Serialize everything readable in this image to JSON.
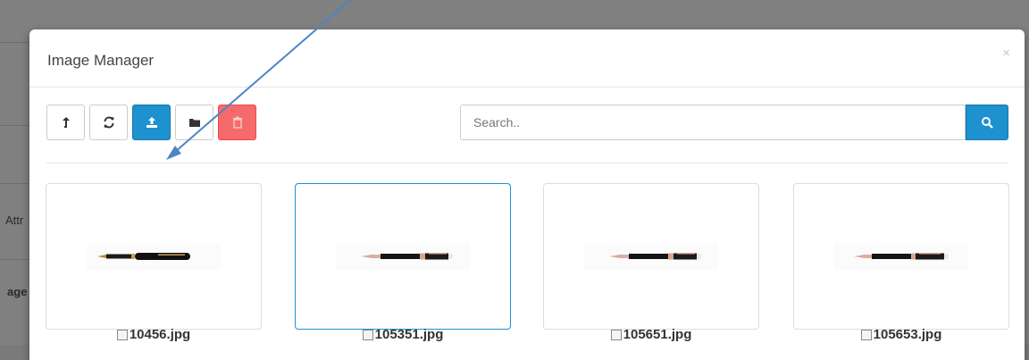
{
  "background": {
    "side_text_1": "Attr",
    "side_text_2": "age"
  },
  "modal": {
    "title": "Image Manager",
    "close_label": "×"
  },
  "toolbar": {
    "buttons": [
      {
        "name": "parent-button",
        "icon": "level-up-icon",
        "style": "default"
      },
      {
        "name": "refresh-button",
        "icon": "refresh-icon",
        "style": "default"
      },
      {
        "name": "upload-button",
        "icon": "upload-icon",
        "style": "primary"
      },
      {
        "name": "new-folder-button",
        "icon": "folder-icon",
        "style": "default"
      },
      {
        "name": "delete-button",
        "icon": "trash-icon",
        "style": "danger"
      }
    ]
  },
  "search": {
    "placeholder": "Search..",
    "value": "",
    "button_icon": "search-icon"
  },
  "images": [
    {
      "filename": "10456.jpg",
      "selected": false
    },
    {
      "filename": "105351.jpg",
      "selected": true
    },
    {
      "filename": "105651.jpg",
      "selected": false
    },
    {
      "filename": "105653.jpg",
      "selected": false
    }
  ],
  "colors": {
    "primary": "#1e91cf",
    "danger": "#f56b6b",
    "annotation_arrow": "#4a86c5"
  }
}
